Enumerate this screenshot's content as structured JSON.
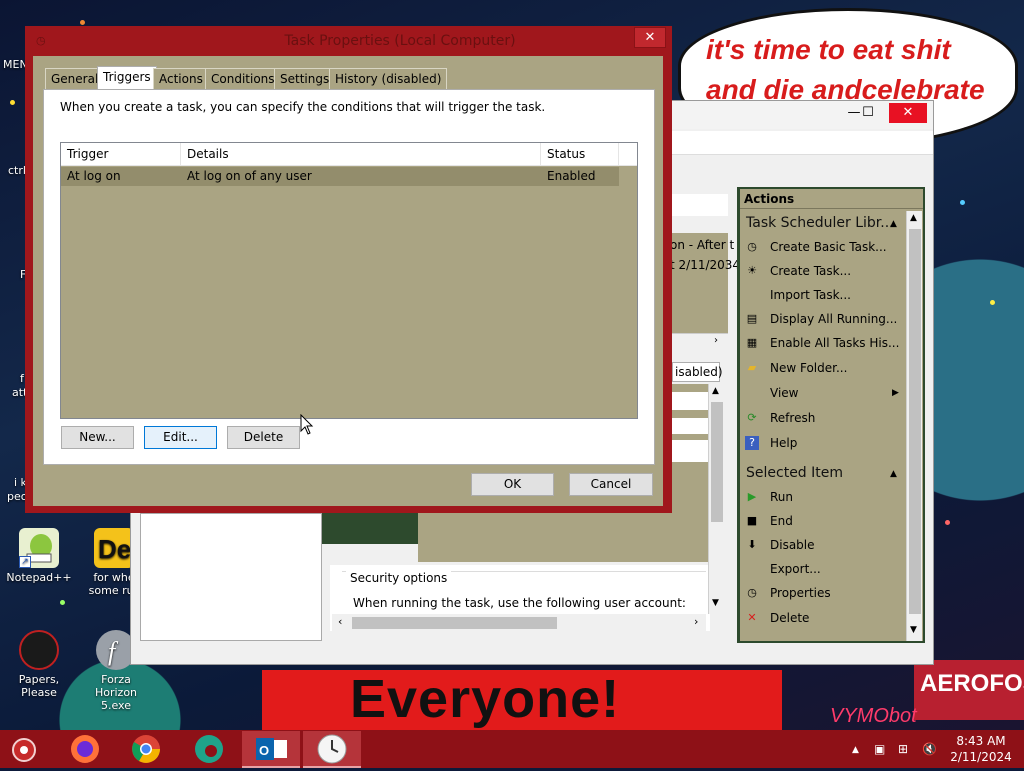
{
  "desktop": {
    "speech_line1": "it's time to eat shit",
    "speech_line2": "and die andcelebrate",
    "banner": "Everyone!",
    "right_sign": "AEROFOS",
    "neon": "VYMObot",
    "edge_labels": [
      "MEN",
      "ctrl-",
      "F",
      "f",
      "att",
      "i kr",
      "peo"
    ],
    "icons": [
      {
        "label": "Notepad++"
      },
      {
        "label": "for whe some rus"
      },
      {
        "label": "Papers, Please"
      },
      {
        "label": "Forza Horizon 5.exe"
      }
    ]
  },
  "task_scheduler": {
    "partial_text1": "on - After t",
    "partial_text2": "t 2/11/2034",
    "partial_tab": "isabled)",
    "security_header": "Security options",
    "security_text": "When running the task, use the following user account:",
    "actions": {
      "header": "Actions",
      "section1": "Task Scheduler Libr...",
      "items1": [
        {
          "label": "Create Basic Task...",
          "icon": "create-basic-task-icon"
        },
        {
          "label": "Create Task...",
          "icon": "create-task-icon"
        },
        {
          "label": "Import Task...",
          "icon": ""
        },
        {
          "label": "Display All Running...",
          "icon": "display-running-icon"
        },
        {
          "label": "Enable All Tasks His...",
          "icon": "enable-history-icon"
        },
        {
          "label": "New Folder...",
          "icon": "folder-icon"
        },
        {
          "label": "View",
          "icon": ""
        },
        {
          "label": "Refresh",
          "icon": "refresh-icon"
        },
        {
          "label": "Help",
          "icon": "help-icon"
        }
      ],
      "section2": "Selected Item",
      "items2": [
        {
          "label": "Run",
          "icon": "run-icon"
        },
        {
          "label": "End",
          "icon": "end-icon"
        },
        {
          "label": "Disable",
          "icon": "disable-icon"
        },
        {
          "label": "Export...",
          "icon": ""
        },
        {
          "label": "Properties",
          "icon": "properties-icon"
        },
        {
          "label": "Delete",
          "icon": "delete-icon"
        }
      ]
    }
  },
  "dialog": {
    "title": "Task Properties (Local Computer)",
    "close": "✕",
    "tabs": [
      "General",
      "Triggers",
      "Actions",
      "Conditions",
      "Settings",
      "History (disabled)"
    ],
    "active_tab": "Triggers",
    "intro": "When you create a task, you can specify the conditions that will trigger the task.",
    "columns": [
      "Trigger",
      "Details",
      "Status"
    ],
    "rows": [
      {
        "trigger": "At log on",
        "details": "At log on of any user",
        "status": "Enabled"
      }
    ],
    "buttons": {
      "new": "New...",
      "edit": "Edit...",
      "delete": "Delete",
      "ok": "OK",
      "cancel": "Cancel"
    }
  },
  "taskbar": {
    "time": "8:43 AM",
    "date": "2/11/2024",
    "apps": [
      "firefox",
      "chrome",
      "edge",
      "outlook",
      "task-scheduler"
    ]
  },
  "colors": {
    "dialog_frame": "#a0171c",
    "dialog_body": "#aaa483",
    "taskbar": "#8e1117",
    "selected_row": "#938d6c"
  }
}
